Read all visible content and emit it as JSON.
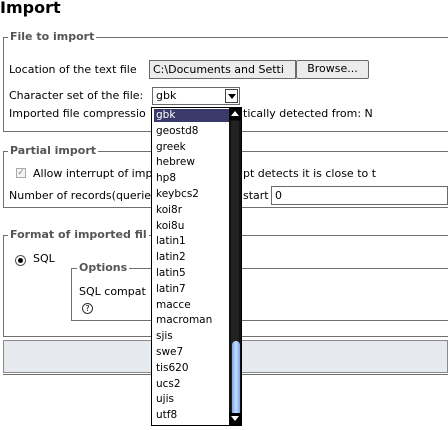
{
  "page": {
    "title": "Import"
  },
  "file_to_import": {
    "legend": "File to import",
    "location_label": "Location of the text file",
    "location_value": "C:\\Documents and Setti",
    "browse_label": "Browse...",
    "charset_label": "Character set of the file:",
    "charset_value": "gbk",
    "compression_label": "Imported file compressio",
    "compression_detected": "tically detected from: N"
  },
  "partial_import": {
    "legend": "Partial import",
    "allow_interrupt_label": "Allow interrupt of imp",
    "allow_interrupt_suffix": "pt detects it is close to t",
    "records_label": "Number of records(querie",
    "start_label": "start",
    "start_value": "0"
  },
  "format": {
    "legend": "Format of imported fil",
    "sql_label": "SQL",
    "options_legend": "Options",
    "sql_compat_label": "SQL compat",
    "help_icon": "?"
  },
  "charset_dropdown": {
    "items": [
      "gbk",
      "geostd8",
      "greek",
      "hebrew",
      "hp8",
      "keybcs2",
      "koi8r",
      "koi8u",
      "latin1",
      "latin2",
      "latin5",
      "latin7",
      "macce",
      "macroman",
      "sjis",
      "swe7",
      "tis620",
      "ucs2",
      "ujis",
      "utf8"
    ],
    "selected": "gbk"
  }
}
